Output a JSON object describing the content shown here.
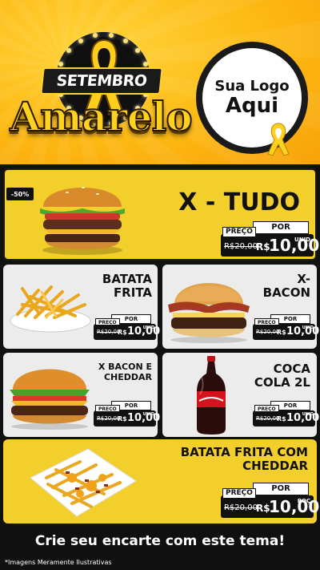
{
  "header": {
    "campaign_top": "SETEMBRO",
    "campaign_main": "Amarelo",
    "logo_line1": "Sua Logo",
    "logo_line2": "Aqui"
  },
  "badge": "-50%",
  "items": [
    {
      "name": "X - TUDO",
      "por": "POR",
      "preco": "PREÇO",
      "old": "R$20,00",
      "currency": "R$",
      "price": "10,00",
      "unit": "UNID",
      "image": "burger-icon"
    },
    {
      "name_line1": "BATATA",
      "name_line2": "FRITA",
      "por": "POR",
      "preco": "PREÇO",
      "old": "R$20,00",
      "currency": "R$",
      "price": "10,00",
      "unit": "UNID",
      "image": "fries-icon"
    },
    {
      "name_line1": "X-",
      "name_line2": "BACON",
      "por": "POR",
      "preco": "PREÇO",
      "old": "R$20,00",
      "currency": "R$",
      "price": "10,00",
      "unit": "UNID",
      "image": "burger-icon"
    },
    {
      "name_line1": "X BACON E",
      "name_line2": "CHEDDAR",
      "por": "POR",
      "preco": "PREÇO",
      "old": "R$20,00",
      "currency": "R$",
      "price": "10,00",
      "unit": "UNID",
      "image": "burger-icon"
    },
    {
      "name_line1": "COCA",
      "name_line2": "COLA 2L",
      "por": "POR",
      "preco": "PREÇO",
      "old": "R$20,00",
      "currency": "R$",
      "price": "10,00",
      "unit": "UNID",
      "image": "soda-bottle-icon"
    },
    {
      "name_line1": "BATATA FRITA COM",
      "name_line2": "CHEDDAR",
      "por": "POR",
      "preco": "PREÇO",
      "old": "R$20,00",
      "currency": "R$",
      "price": "10,00",
      "unit": "POÇ",
      "image": "cheese-fries-icon"
    }
  ],
  "footer": {
    "cta": "Crie seu encarte com este tema!",
    "disclaimer": "*Imagens Meramente Ilustrativas"
  },
  "colors": {
    "yellow": "#f2cf2a",
    "black": "#111111",
    "white": "#ececec",
    "orange": "#fdb913"
  }
}
